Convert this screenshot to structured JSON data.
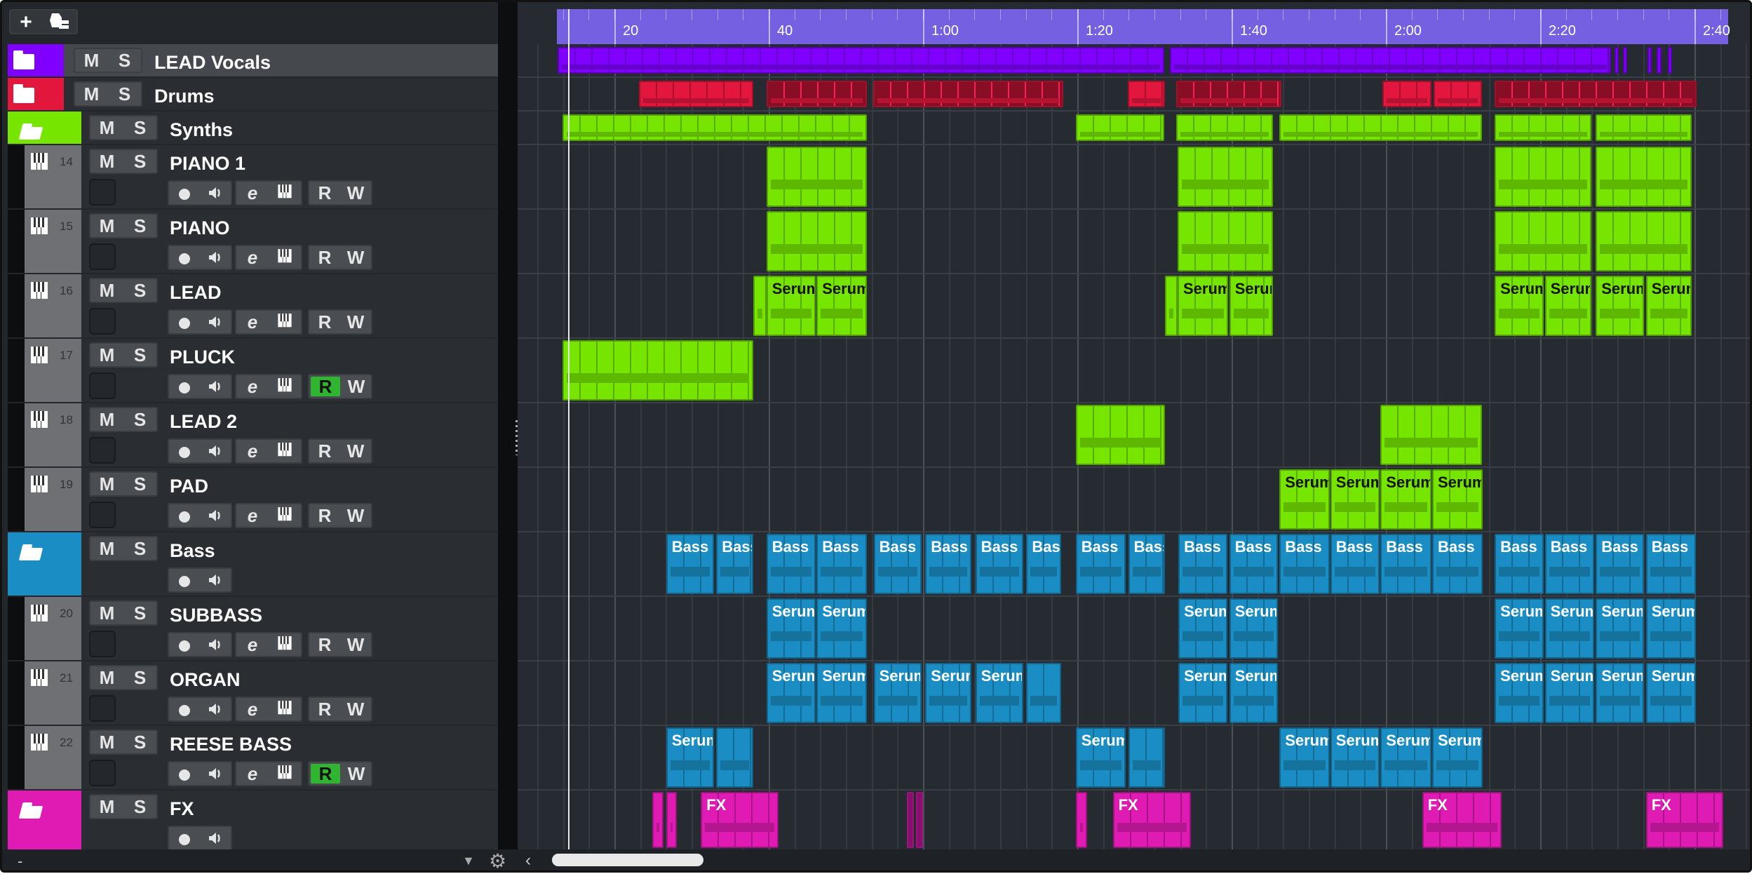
{
  "toolbar": {
    "add_icon": "plus-icon",
    "folder_icon": "folder-tracks-icon"
  },
  "buttons": {
    "mute": "M",
    "solo": "S",
    "read": "R",
    "write": "W"
  },
  "colors": {
    "ruler": "#7460e0",
    "record_active": "#2fb52f",
    "purple": "#8000ff",
    "red": "#e3173d",
    "green": "#76e600",
    "blue": "#1a8ec4",
    "magenta": "#e01bb4"
  },
  "ruler": {
    "start_sec": 12.5,
    "end_sec": 164.4,
    "labels": [
      {
        "t": 20,
        "text": "20"
      },
      {
        "t": 40,
        "text": "40"
      },
      {
        "t": 60,
        "text": "1:00"
      },
      {
        "t": 80,
        "text": "1:20"
      },
      {
        "t": 100,
        "text": "1:40"
      },
      {
        "t": 120,
        "text": "2:00"
      },
      {
        "t": 140,
        "text": "2:20"
      },
      {
        "t": 160,
        "text": "2:40"
      }
    ]
  },
  "playhead_sec": 14,
  "tracks": [
    {
      "name": "LEAD Vocals",
      "kind": "folder",
      "open": false,
      "color": "#8000ff",
      "selected": true,
      "clips": [
        [
          12.6,
          91.3,
          ""
        ],
        [
          92,
          149.2,
          ""
        ],
        [
          149.6,
          150.2,
          ""
        ],
        [
          150.7,
          151.3,
          ""
        ],
        [
          153.9,
          154.5,
          ""
        ],
        [
          155.1,
          155.7,
          ""
        ],
        [
          156.5,
          157.1,
          ""
        ]
      ]
    },
    {
      "name": "Drums",
      "kind": "folder",
      "open": false,
      "color": "#e3173d",
      "clips": [
        [
          23.2,
          38,
          ""
        ],
        [
          39.7,
          52.7,
          "",
          1
        ],
        [
          53.5,
          78.2,
          "",
          1
        ],
        [
          86.5,
          91.4,
          ""
        ],
        [
          92.8,
          106.5,
          "",
          1
        ],
        [
          119.5,
          125.9,
          ""
        ],
        [
          126.2,
          132.5,
          ""
        ],
        [
          134.1,
          160.3,
          "",
          1
        ]
      ]
    },
    {
      "name": "Synths",
      "kind": "folder",
      "open": true,
      "color": "#76e600",
      "clips": [
        [
          13.3,
          52.7,
          ""
        ],
        [
          79.8,
          91.3,
          ""
        ],
        [
          92.8,
          105.4,
          ""
        ],
        [
          106.2,
          132.5,
          ""
        ],
        [
          134.1,
          146.6,
          ""
        ],
        [
          147.2,
          159.6,
          ""
        ]
      ]
    },
    {
      "name": "PIANO 1",
      "kind": "inst",
      "number": "14",
      "color": "#76e600",
      "r_on": false,
      "clips": [
        [
          39.7,
          52.7,
          ""
        ],
        [
          93,
          105.4,
          ""
        ],
        [
          134.1,
          146.6,
          ""
        ],
        [
          147.2,
          159.6,
          ""
        ]
      ]
    },
    {
      "name": "PIANO",
      "kind": "inst",
      "number": "15",
      "color": "#76e600",
      "r_on": false,
      "clips": [
        [
          39.7,
          52.7,
          ""
        ],
        [
          93,
          105.4,
          ""
        ],
        [
          134.1,
          146.6,
          ""
        ],
        [
          147.2,
          159.6,
          ""
        ]
      ]
    },
    {
      "name": "LEAD",
      "kind": "inst",
      "number": "16",
      "color": "#76e600",
      "r_on": false,
      "clips": [
        [
          38,
          39.7,
          ""
        ],
        [
          39.7,
          46.1,
          "Serum"
        ],
        [
          46.2,
          52.7,
          "Serum"
        ],
        [
          91.4,
          93,
          ""
        ],
        [
          93,
          99.5,
          "Serum"
        ],
        [
          99.7,
          105.4,
          "Serum"
        ],
        [
          134.1,
          140.5,
          "Serum"
        ],
        [
          140.6,
          146.6,
          "Serum"
        ],
        [
          147.2,
          153.5,
          "Serum"
        ],
        [
          153.7,
          159.6,
          "Serum"
        ]
      ]
    },
    {
      "name": "PLUCK",
      "kind": "inst",
      "number": "17",
      "color": "#76e600",
      "r_on": true,
      "clips": [
        [
          13.3,
          38,
          ""
        ]
      ]
    },
    {
      "name": "LEAD 2",
      "kind": "inst",
      "number": "18",
      "color": "#76e600",
      "r_on": false,
      "clips": [
        [
          79.8,
          91.4,
          ""
        ],
        [
          119.3,
          132.5,
          ""
        ]
      ]
    },
    {
      "name": "PAD",
      "kind": "inst",
      "number": "19",
      "color": "#76e600",
      "r_on": false,
      "clips": [
        [
          106.2,
          112.7,
          "Serum"
        ],
        [
          112.8,
          119.2,
          "Serum"
        ],
        [
          119.3,
          125.9,
          "Serum"
        ],
        [
          126,
          132.5,
          "Serum"
        ]
      ]
    },
    {
      "name": "Bass",
      "kind": "folder",
      "open": true,
      "color": "#1a8ec4",
      "clips": [
        [
          26.7,
          32.9,
          "Bass"
        ],
        [
          33.2,
          38,
          "Bass"
        ],
        [
          39.7,
          46.1,
          "Bass"
        ],
        [
          46.2,
          52.7,
          "Bass"
        ],
        [
          53.6,
          59.8,
          "Bass"
        ],
        [
          60.3,
          66.3,
          "Bass"
        ],
        [
          66.8,
          73,
          "Bass"
        ],
        [
          73.4,
          77.9,
          "Bass"
        ],
        [
          79.8,
          86.3,
          "Bass"
        ],
        [
          86.6,
          91.4,
          "Bass"
        ],
        [
          93.1,
          99.5,
          "Bass"
        ],
        [
          99.7,
          106,
          "Bass"
        ],
        [
          106.2,
          112.7,
          "Bass"
        ],
        [
          112.8,
          119.2,
          "Bass"
        ],
        [
          119.3,
          125.9,
          "Bass"
        ],
        [
          126,
          132.5,
          "Bass"
        ],
        [
          134.1,
          140.5,
          "Bass"
        ],
        [
          140.6,
          147,
          "Bass"
        ],
        [
          147.2,
          153.5,
          "Bass"
        ],
        [
          153.7,
          160.2,
          "Bass"
        ]
      ]
    },
    {
      "name": "SUBBASS",
      "kind": "inst",
      "number": "20",
      "color": "#1a8ec4",
      "r_on": false,
      "clips": [
        [
          39.7,
          46.1,
          "Serum"
        ],
        [
          46.2,
          52.7,
          "Serum"
        ],
        [
          93.1,
          99.5,
          "Serum"
        ],
        [
          99.7,
          106,
          "Serum"
        ],
        [
          134.1,
          140.5,
          "Serum"
        ],
        [
          140.6,
          147,
          "Serum"
        ],
        [
          147.2,
          153.5,
          "Serum"
        ],
        [
          153.7,
          160.2,
          "Serum"
        ]
      ]
    },
    {
      "name": "ORGAN",
      "kind": "inst",
      "number": "21",
      "color": "#1a8ec4",
      "r_on": false,
      "clips": [
        [
          39.7,
          46.1,
          "Serum"
        ],
        [
          46.2,
          52.7,
          "Serum"
        ],
        [
          53.6,
          59.8,
          "Serum"
        ],
        [
          60.3,
          66.3,
          "Serum"
        ],
        [
          66.8,
          73,
          "Serum"
        ],
        [
          73.4,
          77.9,
          ""
        ],
        [
          93.1,
          99.5,
          "Serum"
        ],
        [
          99.7,
          106,
          "Serum"
        ],
        [
          134.1,
          140.5,
          "Serum"
        ],
        [
          140.6,
          147,
          "Serum"
        ],
        [
          147.2,
          153.5,
          "Serum"
        ],
        [
          153.7,
          160.2,
          "Serum"
        ]
      ]
    },
    {
      "name": "REESE BASS",
      "kind": "inst",
      "number": "22",
      "color": "#1a8ec4",
      "r_on": true,
      "clips": [
        [
          26.7,
          32.9,
          "Serum"
        ],
        [
          33.2,
          38,
          ""
        ],
        [
          79.8,
          86.3,
          "Serum"
        ],
        [
          86.6,
          91.4,
          ""
        ],
        [
          106.2,
          112.7,
          "Serum"
        ],
        [
          112.8,
          119.2,
          "Serum"
        ],
        [
          119.3,
          125.9,
          "Serum"
        ],
        [
          126,
          132.5,
          "Serum"
        ]
      ]
    },
    {
      "name": "FX",
      "kind": "folder",
      "open": true,
      "color": "#e01bb4",
      "clips": [
        [
          24.9,
          26.4,
          ""
        ],
        [
          26.7,
          28.1,
          ""
        ],
        [
          31.2,
          41.3,
          "FX"
        ],
        [
          57.9,
          58.8,
          "",
          1
        ],
        [
          59.1,
          60,
          "",
          1
        ],
        [
          79.8,
          81.3,
          ""
        ],
        [
          84.6,
          94.7,
          "FX"
        ],
        [
          124.7,
          135,
          "FX"
        ],
        [
          153.7,
          163.7,
          "FX"
        ]
      ]
    }
  ],
  "bottom": {
    "collapse_label": "-"
  }
}
